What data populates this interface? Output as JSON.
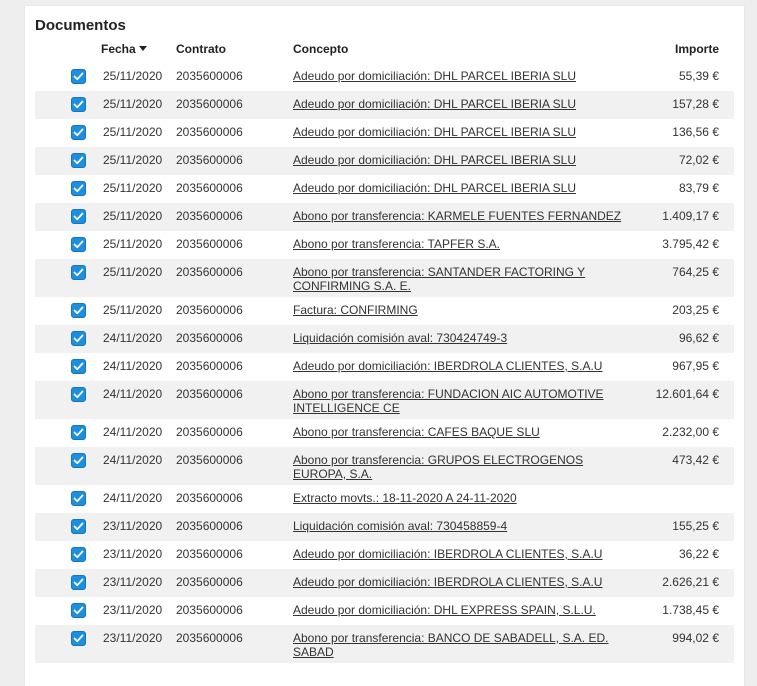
{
  "panel": {
    "title": "Documentos",
    "columns": {
      "fecha": "Fecha",
      "contrato": "Contrato",
      "concepto": "Concepto",
      "importe": "Importe"
    },
    "sort_icon": "caret-down-icon",
    "checkbox_icon": "checkmark-icon",
    "accent_color": "#1d8fe1"
  },
  "rows": [
    {
      "fecha": "25/11/2020",
      "contrato": "2035600006",
      "concepto": "Adeudo por domiciliación: DHL PARCEL IBERIA SLU",
      "importe": "55,39 €",
      "checked": true
    },
    {
      "fecha": "25/11/2020",
      "contrato": "2035600006",
      "concepto": "Adeudo por domiciliación: DHL PARCEL IBERIA SLU",
      "importe": "157,28 €",
      "checked": true
    },
    {
      "fecha": "25/11/2020",
      "contrato": "2035600006",
      "concepto": "Adeudo por domiciliación: DHL PARCEL IBERIA SLU",
      "importe": "136,56 €",
      "checked": true
    },
    {
      "fecha": "25/11/2020",
      "contrato": "2035600006",
      "concepto": "Adeudo por domiciliación: DHL PARCEL IBERIA SLU",
      "importe": "72,02 €",
      "checked": true
    },
    {
      "fecha": "25/11/2020",
      "contrato": "2035600006",
      "concepto": "Adeudo por domiciliación: DHL PARCEL IBERIA SLU",
      "importe": "83,79 €",
      "checked": true
    },
    {
      "fecha": "25/11/2020",
      "contrato": "2035600006",
      "concepto": "Abono por transferencia: KARMELE FUENTES FERNANDEZ",
      "importe": "1.409,17 €",
      "checked": true
    },
    {
      "fecha": "25/11/2020",
      "contrato": "2035600006",
      "concepto": "Abono por transferencia: TAPFER S.A.",
      "importe": "3.795,42 €",
      "checked": true
    },
    {
      "fecha": "25/11/2020",
      "contrato": "2035600006",
      "concepto": "Abono por transferencia: SANTANDER FACTORING Y CONFIRMING S.A. E.",
      "importe": "764,25 €",
      "checked": true
    },
    {
      "fecha": "25/11/2020",
      "contrato": "2035600006",
      "concepto": "Factura: CONFIRMING",
      "importe": "203,25 €",
      "checked": true
    },
    {
      "fecha": "24/11/2020",
      "contrato": "2035600006",
      "concepto": "Liquidación comisión aval: 730424749-3",
      "importe": "96,62 €",
      "checked": true
    },
    {
      "fecha": "24/11/2020",
      "contrato": "2035600006",
      "concepto": "Adeudo por domiciliación: IBERDROLA CLIENTES, S.A.U",
      "importe": "967,95 €",
      "checked": true
    },
    {
      "fecha": "24/11/2020",
      "contrato": "2035600006",
      "concepto": "Abono por transferencia: FUNDACION AIC AUTOMOTIVE INTELLIGENCE CE",
      "importe": "12.601,64 €",
      "checked": true
    },
    {
      "fecha": "24/11/2020",
      "contrato": "2035600006",
      "concepto": "Abono por transferencia: CAFES BAQUE SLU",
      "importe": "2.232,00 €",
      "checked": true
    },
    {
      "fecha": "24/11/2020",
      "contrato": "2035600006",
      "concepto": "Abono por transferencia: GRUPOS ELECTROGENOS EUROPA, S.A.",
      "importe": "473,42 €",
      "checked": true
    },
    {
      "fecha": "24/11/2020",
      "contrato": "2035600006",
      "concepto": "Extracto movts.: 18-11-2020 A 24-11-2020",
      "importe": "",
      "checked": true
    },
    {
      "fecha": "23/11/2020",
      "contrato": "2035600006",
      "concepto": "Liquidación comisión aval: 730458859-4",
      "importe": "155,25 €",
      "checked": true
    },
    {
      "fecha": "23/11/2020",
      "contrato": "2035600006",
      "concepto": "Adeudo por domiciliación: IBERDROLA CLIENTES, S.A.U",
      "importe": "36,22 €",
      "checked": true
    },
    {
      "fecha": "23/11/2020",
      "contrato": "2035600006",
      "concepto": "Adeudo por domiciliación: IBERDROLA CLIENTES, S.A.U",
      "importe": "2.626,21 €",
      "checked": true
    },
    {
      "fecha": "23/11/2020",
      "contrato": "2035600006",
      "concepto": "Adeudo por domiciliación: DHL EXPRESS SPAIN, S.L.U.",
      "importe": "1.738,45 €",
      "checked": true
    },
    {
      "fecha": "23/11/2020",
      "contrato": "2035600006",
      "concepto": "Abono por transferencia: BANCO DE SABADELL, S.A. ED. SABAD",
      "importe": "994,02 €",
      "checked": true
    }
  ]
}
